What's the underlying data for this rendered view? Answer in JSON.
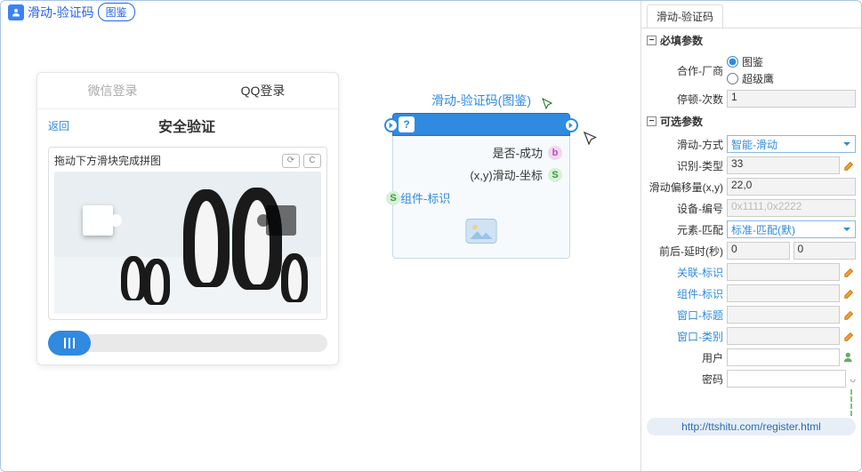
{
  "header": {
    "title": "滑动-验证码",
    "badge": "图鉴"
  },
  "captcha": {
    "tabs": [
      "微信登录",
      "QQ登录"
    ],
    "activeTab": 1,
    "return": "返回",
    "verifyTitle": "安全验证",
    "instruction": "拖动下方滑块完成拼图"
  },
  "node": {
    "title": "滑动-验证码(图鉴)",
    "q": "?",
    "rows": [
      {
        "label": "是否-成功",
        "pill": "b"
      },
      {
        "label": "(x,y)滑动-坐标",
        "pill": "S"
      }
    ],
    "compLabel": "组件-标识"
  },
  "side": {
    "tab": "滑动-验证码",
    "required": {
      "title": "必填参数",
      "vendor": {
        "label": "合作-厂商",
        "options": [
          "图鉴",
          "超级鹰"
        ],
        "selected": 0
      },
      "pause": {
        "label": "停顿-次数",
        "value": "1"
      }
    },
    "optional": {
      "title": "可选参数",
      "mode": {
        "label": "滑动-方式",
        "value": "智能-滑动"
      },
      "type": {
        "label": "识别-类型",
        "value": "33"
      },
      "offset": {
        "label": "滑动偏移量(x,y)",
        "value": "22,0"
      },
      "device": {
        "label": "设备-编号",
        "placeholder": "0x1111,0x2222"
      },
      "match": {
        "label": "元素-匹配",
        "value": "标准-匹配(默)"
      },
      "delay": {
        "label": "前后-延时(秒)",
        "v1": "0",
        "v2": "0"
      },
      "relTag": {
        "label": "关联-标识",
        "value": ""
      },
      "compTag": {
        "label": "组件-标识",
        "value": ""
      },
      "winTitle": {
        "label": "窗口-标题",
        "value": ""
      },
      "winClass": {
        "label": "窗口-类别",
        "value": ""
      },
      "user": {
        "label": "用户",
        "value": ""
      },
      "pass": {
        "label": "密码",
        "value": ""
      }
    },
    "registerUrl": "http://ttshitu.com/register.html"
  }
}
